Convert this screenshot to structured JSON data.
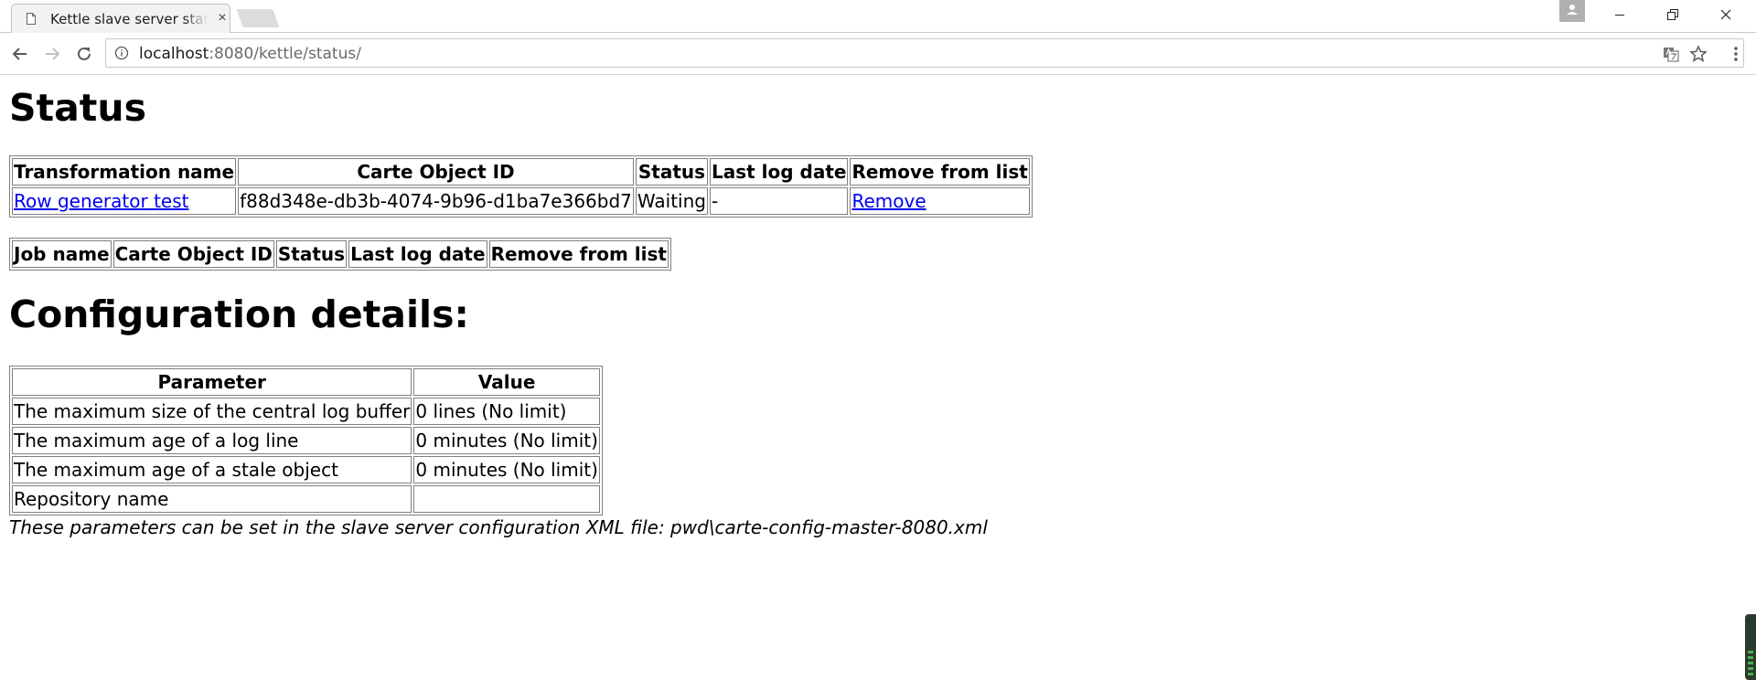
{
  "browser": {
    "tab_title": "Kettle slave server status",
    "tab_close_glyph": "×",
    "url_host": "localhost",
    "url_rest": ":8080/kettle/status/"
  },
  "page": {
    "heading_status": "Status",
    "heading_config": "Configuration details:",
    "transformations_table": {
      "headers": [
        "Transformation name",
        "Carte Object ID",
        "Status",
        "Last log date",
        "Remove from list"
      ],
      "rows": [
        {
          "name": "Row generator test",
          "object_id": "f88d348e-db3b-4074-9b96-d1ba7e366bd7",
          "status": "Waiting",
          "last_log_date": "-",
          "remove": "Remove"
        }
      ]
    },
    "jobs_table": {
      "headers": [
        "Job name",
        "Carte Object ID",
        "Status",
        "Last log date",
        "Remove from list"
      ],
      "rows": []
    },
    "config_table": {
      "headers": [
        "Parameter",
        "Value"
      ],
      "rows": [
        {
          "parameter": "The maximum size of the central log buffer",
          "value": "0 lines (No limit)"
        },
        {
          "parameter": "The maximum age of a log line",
          "value": "0 minutes (No limit)"
        },
        {
          "parameter": "The maximum age of a stale object",
          "value": "0 minutes (No limit)"
        },
        {
          "parameter": "Repository name",
          "value": ""
        }
      ]
    },
    "config_note": "These parameters can be set in the slave server configuration XML file: pwd\\carte-config-master-8080.xml"
  },
  "colors": {
    "link": "#0000ee",
    "tab_bg": "#f2f2f2",
    "border": "#808080"
  }
}
